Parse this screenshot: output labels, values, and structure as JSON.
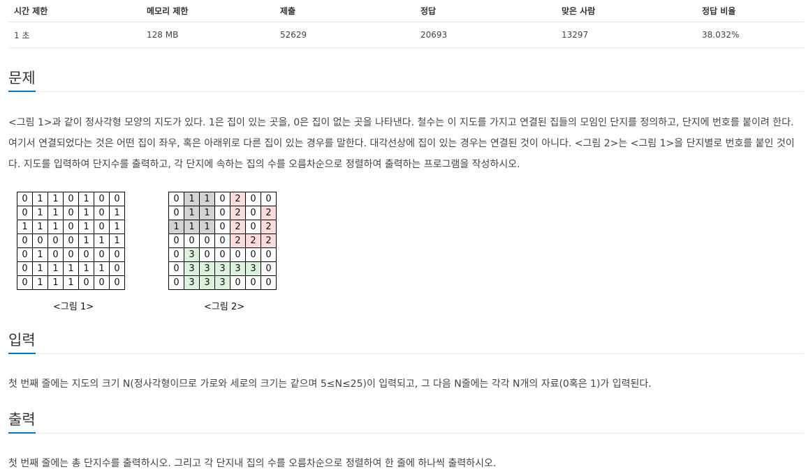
{
  "stats": {
    "headers": [
      "시간 제한",
      "메모리 제한",
      "제출",
      "정답",
      "맞은 사람",
      "정답 비율"
    ],
    "values": [
      "1 초",
      "128 MB",
      "52629",
      "20693",
      "13297",
      "38.032%"
    ]
  },
  "problem": {
    "title": "문제",
    "text": "<그림 1>과 같이 정사각형 모양의 지도가 있다. 1은 집이 있는 곳을, 0은 집이 없는 곳을 나타낸다. 철수는 이 지도를 가지고 연결된 집들의 모임인 단지를 정의하고, 단지에 번호를 붙이려 한다. 여기서 연결되었다는 것은 어떤 집이 좌우, 혹은 아래위로 다른 집이 있는 경우를 말한다. 대각선상에 집이 있는 경우는 연결된 것이 아니다. <그림 2>는 <그림 1>을 단지별로 번호를 붙인 것이다. 지도를 입력하여 단지수를 출력하고, 각 단지에 속하는 집의 수를 오름차순으로 정렬하여 출력하는 프로그램을 작성하시오."
  },
  "figure1": {
    "caption": "<그림 1>",
    "grid": [
      [
        "0",
        "1",
        "1",
        "0",
        "1",
        "0",
        "0"
      ],
      [
        "0",
        "1",
        "1",
        "0",
        "1",
        "0",
        "1"
      ],
      [
        "1",
        "1",
        "1",
        "0",
        "1",
        "0",
        "1"
      ],
      [
        "0",
        "0",
        "0",
        "0",
        "1",
        "1",
        "1"
      ],
      [
        "0",
        "1",
        "0",
        "0",
        "0",
        "0",
        "0"
      ],
      [
        "0",
        "1",
        "1",
        "1",
        "1",
        "1",
        "0"
      ],
      [
        "0",
        "1",
        "1",
        "1",
        "0",
        "0",
        "0"
      ]
    ]
  },
  "figure2": {
    "caption": "<그림 2>",
    "grid": [
      [
        "0",
        "1",
        "1",
        "0",
        "2",
        "0",
        "0"
      ],
      [
        "0",
        "1",
        "1",
        "0",
        "2",
        "0",
        "2"
      ],
      [
        "1",
        "1",
        "1",
        "0",
        "2",
        "0",
        "2"
      ],
      [
        "0",
        "0",
        "0",
        "0",
        "2",
        "2",
        "2"
      ],
      [
        "0",
        "3",
        "0",
        "0",
        "0",
        "0",
        "0"
      ],
      [
        "0",
        "3",
        "3",
        "3",
        "3",
        "3",
        "0"
      ],
      [
        "0",
        "3",
        "3",
        "3",
        "0",
        "0",
        "0"
      ]
    ],
    "colors": {
      "1": "#d3d3d3",
      "2": "#fbdcdc",
      "3": "#dcf2dc"
    }
  },
  "input": {
    "title": "입력",
    "text": "첫 번째 줄에는 지도의 크기 N(정사각형이므로 가로와 세로의 크기는 같으며 5≤N≤25)이 입력되고, 그 다음 N줄에는 각각 N개의 자료(0혹은 1)가 입력된다."
  },
  "output": {
    "title": "출력",
    "text": "첫 번째 줄에는 총 단지수를 출력하시오. 그리고 각 단지내 집의 수를 오름차순으로 정렬하여 한 줄에 하나씩 출력하시오."
  },
  "accent_color": "#0076c0"
}
